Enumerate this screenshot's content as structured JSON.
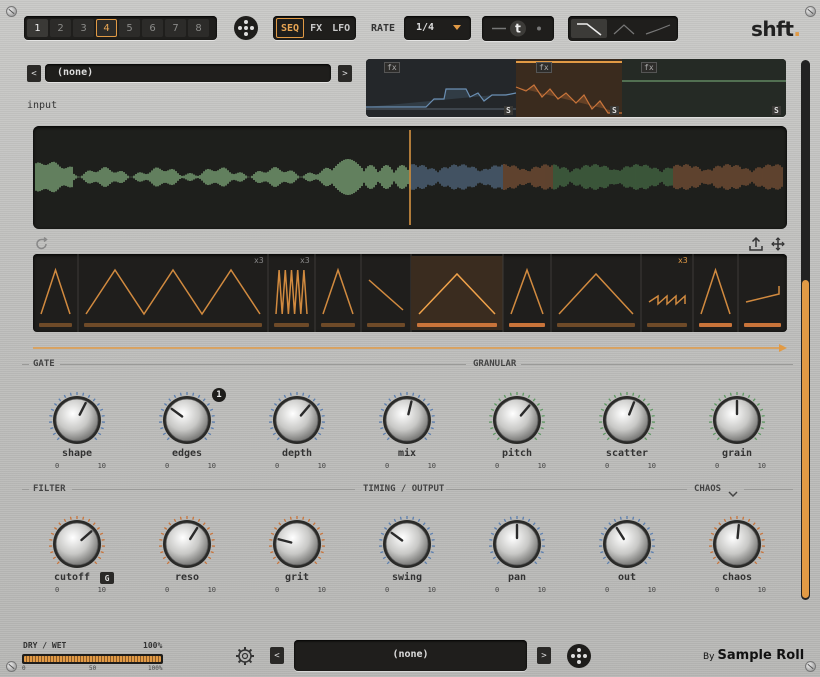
{
  "header": {
    "pages": [
      "1",
      "2",
      "3",
      "4",
      "5",
      "6",
      "7",
      "8"
    ],
    "active_page": "4",
    "modes": [
      "SEQ",
      "FX",
      "LFO"
    ],
    "active_mode": "SEQ",
    "rate_label": "RATE",
    "rate_value": "1/4",
    "t_glyph": "t",
    "logo_text": "shft",
    "logo_dot": "."
  },
  "preset": {
    "prev": "<",
    "next": ">",
    "name": "(none)",
    "input_label": "input"
  },
  "fx_overview": {
    "tags": [
      "fx",
      "fx",
      "fx"
    ],
    "s_tags": [
      "S",
      "S",
      "S"
    ]
  },
  "sequencer": {
    "repeat_labels": [
      "x3",
      "x3",
      "x3"
    ]
  },
  "sections": {
    "gate": "GATE",
    "granular": "GRANULAR",
    "filter": "FILTER",
    "timing": "TIMING / OUTPUT",
    "chaos": "CHAOS"
  },
  "knobs_row1": [
    {
      "label": "shape",
      "min": "0",
      "max": "10",
      "value": 0.6,
      "ring": "blue"
    },
    {
      "label": "edges",
      "min": "0",
      "max": "10",
      "value": 0.3,
      "ring": "blue",
      "badge": "1"
    },
    {
      "label": "depth",
      "min": "0",
      "max": "10",
      "value": 0.65,
      "ring": "blue"
    },
    {
      "label": "mix",
      "min": "0",
      "max": "10",
      "value": 0.55,
      "ring": "blue"
    },
    {
      "label": "pitch",
      "min": "0",
      "max": "10",
      "value": 0.65,
      "ring": "green"
    },
    {
      "label": "scatter",
      "min": "0",
      "max": "10",
      "value": 0.58,
      "ring": "green"
    },
    {
      "label": "grain",
      "min": "0",
      "max": "10",
      "value": 0.5,
      "ring": "green"
    }
  ],
  "knobs_row2": [
    {
      "label": "cutoff",
      "min": "0",
      "max": "10",
      "value": 0.68,
      "ring": "orange",
      "badge_text": "G"
    },
    {
      "label": "reso",
      "min": "0",
      "max": "10",
      "value": 0.62,
      "ring": "orange"
    },
    {
      "label": "grit",
      "min": "0",
      "max": "10",
      "value": 0.22,
      "ring": "orange"
    },
    {
      "label": "swing",
      "min": "0",
      "max": "10",
      "value": 0.3,
      "ring": "blue"
    },
    {
      "label": "pan",
      "min": "0",
      "max": "10",
      "value": 0.5,
      "ring": "blue"
    },
    {
      "label": "out",
      "min": "0",
      "max": "10",
      "value": 0.38,
      "ring": "blue"
    },
    {
      "label": "chaos",
      "min": "0",
      "max": "10",
      "value": 0.52,
      "ring": "orange"
    }
  ],
  "bottom": {
    "drywet_label": "DRY / WET",
    "drywet_value": "100%",
    "drywet_fill": 1.0,
    "drywet_ticks": [
      "0",
      "50",
      "100%"
    ],
    "preset_name": "(none)",
    "prev": "<",
    "next": ">",
    "brand_by": "By",
    "brand_name": "Sample Roll"
  },
  "colors": {
    "accent": "#e19a45",
    "blue": "#5b7fb0",
    "green": "#5e9a63",
    "orange": "#c9743a",
    "panel_dark": "#1f1e1c"
  }
}
